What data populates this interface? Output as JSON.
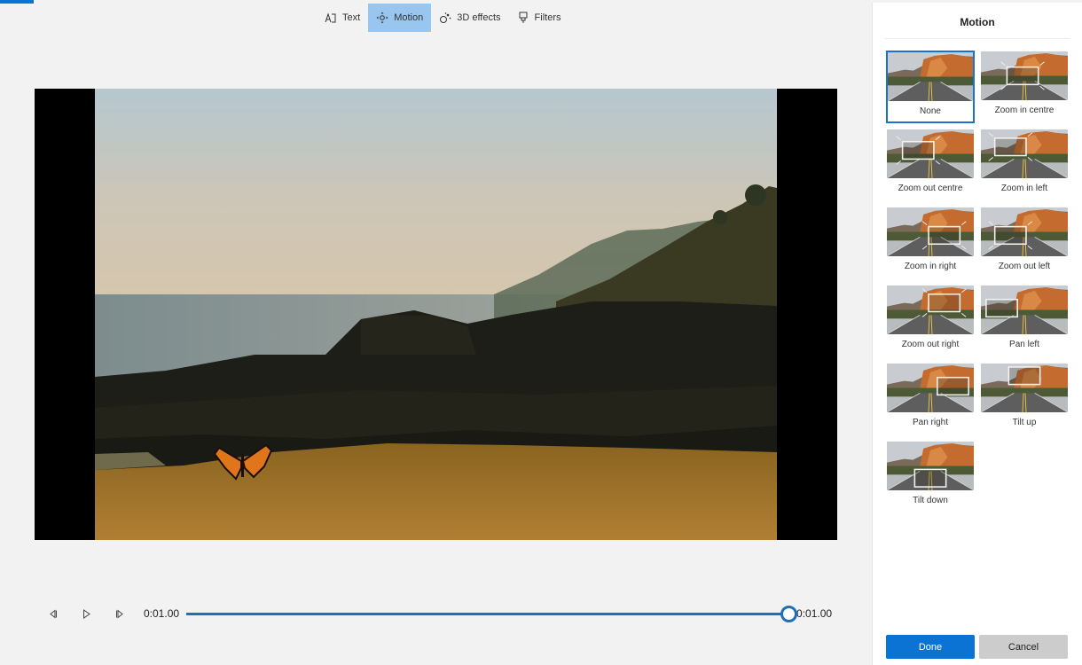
{
  "colors": {
    "accent": "#0a74d4",
    "toolbar_active": "#99c6ef",
    "seek": "#1f6eb8",
    "selected_border": "#1a73c8",
    "done_bg": "#0a73d4",
    "cancel_bg": "#cccccc"
  },
  "toolbar": {
    "items": [
      {
        "label": "Text",
        "icon": "text-icon",
        "active": false
      },
      {
        "label": "Motion",
        "icon": "motion-icon",
        "active": true
      },
      {
        "label": "3D effects",
        "icon": "3d-effects-icon",
        "active": false
      },
      {
        "label": "Filters",
        "icon": "filters-icon",
        "active": false
      }
    ]
  },
  "preview": {
    "description": "Beach at sunset with rocks, sea and hills; butterfly sticker on sand"
  },
  "playback": {
    "current_time": "0:01.00",
    "end_time": "0:01.00",
    "progress_percent": 100
  },
  "panel": {
    "title": "Motion",
    "options": [
      {
        "label": "None",
        "selected": true,
        "motion": "none"
      },
      {
        "label": "Zoom in centre",
        "selected": false,
        "motion": "zoom-in-centre"
      },
      {
        "label": "Zoom out centre",
        "selected": false,
        "motion": "zoom-out-centre"
      },
      {
        "label": "Zoom in left",
        "selected": false,
        "motion": "zoom-in-left"
      },
      {
        "label": "Zoom in right",
        "selected": false,
        "motion": "zoom-in-right"
      },
      {
        "label": "Zoom out left",
        "selected": false,
        "motion": "zoom-out-left"
      },
      {
        "label": "Zoom out right",
        "selected": false,
        "motion": "zoom-out-right"
      },
      {
        "label": "Pan left",
        "selected": false,
        "motion": "pan-left"
      },
      {
        "label": "Pan right",
        "selected": false,
        "motion": "pan-right"
      },
      {
        "label": "Tilt up",
        "selected": false,
        "motion": "tilt-up"
      },
      {
        "label": "Tilt down",
        "selected": false,
        "motion": "tilt-down"
      }
    ],
    "done_label": "Done",
    "cancel_label": "Cancel"
  }
}
